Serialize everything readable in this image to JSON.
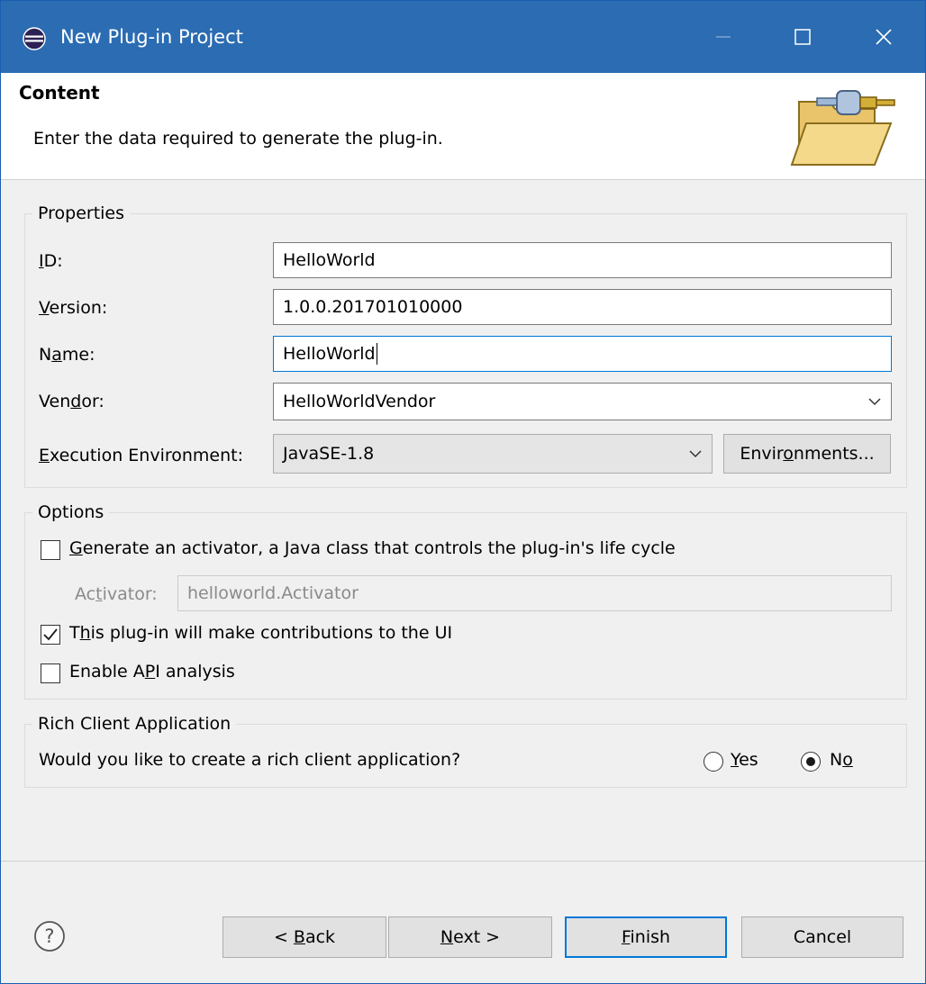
{
  "window": {
    "title": "New Plug-in Project",
    "min_label": "—",
    "max_label": "☐",
    "close_label": "✕"
  },
  "header": {
    "title": "Content",
    "description": "Enter the data required to generate the plug-in."
  },
  "properties": {
    "legend": "Properties",
    "id_label": "ID:",
    "id_value": "HelloWorld",
    "version_label": "Version:",
    "version_value": "1.0.0.201701010000",
    "name_label": "Name:",
    "name_value": "HelloWorld",
    "vendor_label": "Vendor:",
    "vendor_value": "HelloWorldVendor",
    "exec_env_label": "Execution Environment:",
    "exec_env_value": "JavaSE-1.8",
    "environments_button": "Environments..."
  },
  "options": {
    "legend": "Options",
    "generate_activator_label": "Generate an activator, a Java class that controls the plug-in's life cycle",
    "generate_activator_checked": false,
    "activator_label": "Activator:",
    "activator_value": "helloworld.Activator",
    "ui_contrib_label": "This plug-in will make contributions to the UI",
    "ui_contrib_checked": true,
    "api_analysis_label": "Enable API analysis",
    "api_analysis_checked": false
  },
  "rca": {
    "legend": "Rich Client Application",
    "question": "Would you like to create a rich client application?",
    "yes_label": "Yes",
    "no_label": "No",
    "selected": "No"
  },
  "footer": {
    "back_label": "< Back",
    "next_label": "Next >",
    "finish_label": "Finish",
    "cancel_label": "Cancel"
  },
  "colors": {
    "titlebar": "#2b6cb3",
    "focus": "#0078d7"
  }
}
